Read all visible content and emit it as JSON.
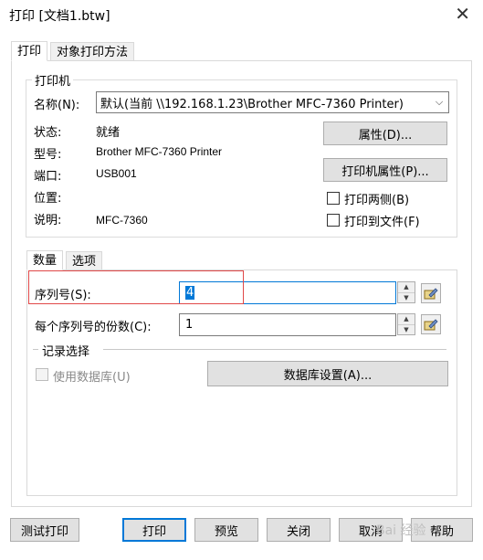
{
  "window": {
    "title": "打印 [文档1.btw]",
    "close": "✕"
  },
  "tabs": {
    "print": "打印",
    "object_print": "对象打印方法"
  },
  "printer": {
    "group_label": "打印机",
    "name_label": "名称(N):",
    "name_value": "默认(当前 \\\\192.168.1.23\\Brother MFC-7360 Printer)",
    "status_label": "状态:",
    "status_value": "就绪",
    "model_label": "型号:",
    "model_value": "Brother MFC-7360 Printer",
    "port_label": "端口:",
    "port_value": "USB001",
    "location_label": "位置:",
    "comment_label": "说明:",
    "comment_value": "MFC-7360",
    "properties_button": "属性(D)...",
    "printer_properties_button": "打印机属性(P)...",
    "duplex_label": "打印两侧(B)",
    "to_file_label": "打印到文件(F)"
  },
  "subtabs": {
    "quantity": "数量",
    "options": "选项"
  },
  "quantity": {
    "serial_label": "序列号(S):",
    "serial_value": "4",
    "copies_label": "每个序列号的份数(C):",
    "copies_value": "1"
  },
  "record": {
    "group_label": "记录选择",
    "use_db_label": "使用数据库(U)",
    "db_settings_button": "数据库设置(A)..."
  },
  "footer": {
    "test_print": "测试打印",
    "print": "打印",
    "preview": "预览",
    "close": "关闭",
    "cancel": "取消",
    "help": "帮助"
  },
  "watermark": "Bai 经验"
}
